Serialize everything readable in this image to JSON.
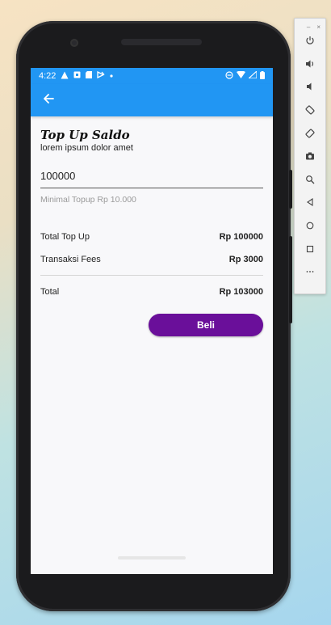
{
  "status_bar": {
    "time": "4:22",
    "left_icons": [
      "warning-icon",
      "warning-icon",
      "sim-icon",
      "cast-icon",
      "dot-icon"
    ],
    "right_icons": [
      "dnd-icon",
      "wifi-icon",
      "signal-icon",
      "battery-icon"
    ]
  },
  "app_bar": {
    "back_icon": "arrow-left-icon",
    "color": "#2196f3"
  },
  "page": {
    "title": "Top Up Saldo",
    "subtitle": "lorem ipsum dolor amet",
    "amount_value": "100000",
    "hint": "Minimal Topup Rp 10.000",
    "summary": [
      {
        "label": "Total Top Up",
        "value": "Rp 100000"
      },
      {
        "label": "Transaksi Fees",
        "value": "Rp 3000"
      }
    ],
    "total": {
      "label": "Total",
      "value": "Rp 103000"
    },
    "buy_button": "Beli",
    "button_color": "#6a0f9a"
  },
  "emulator_toolbar": {
    "window_controls": [
      "–",
      "×"
    ],
    "buttons": [
      "power-icon",
      "volume-up-icon",
      "volume-down-icon",
      "rotate-left-icon",
      "rotate-right-icon",
      "camera-icon",
      "zoom-icon",
      "back-icon",
      "home-icon",
      "overview-icon",
      "more-icon"
    ]
  }
}
